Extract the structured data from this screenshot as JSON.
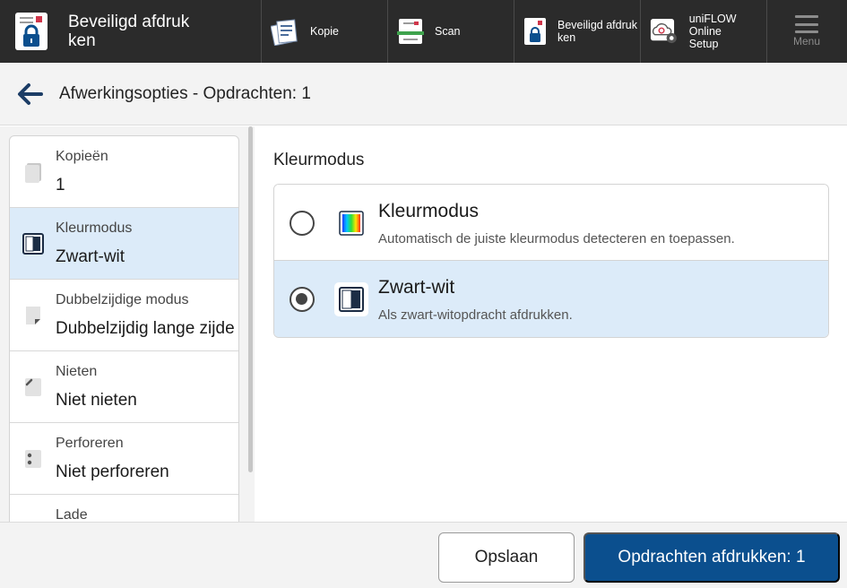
{
  "topbar": {
    "current_app": {
      "title_line1": "Beveiligd afdruk",
      "title_line2": "ken",
      "icon": "secure-print-icon"
    },
    "apps": [
      {
        "label": "Kopie",
        "icon": "copy-icon"
      },
      {
        "label": "Scan",
        "icon": "scan-icon"
      },
      {
        "label_line1": "Beveiligd afdruk",
        "label_line2": "ken",
        "icon": "secure-print-icon"
      },
      {
        "label_line1": "uniFLOW Online",
        "label_line2": "Setup",
        "icon": "cloud-settings-icon"
      }
    ],
    "menu": {
      "label": "Menu",
      "icon": "hamburger-icon"
    }
  },
  "titlebar": {
    "title": "Afwerkingsopties - Opdrachten: 1",
    "back_icon": "arrow-left-icon"
  },
  "settings": [
    {
      "name": "Kopieën",
      "value": "1",
      "icon": "copies-icon"
    },
    {
      "name": "Kleurmodus",
      "value": "Zwart-wit",
      "icon": "black-white-icon",
      "selected": true
    },
    {
      "name": "Dubbelzijdige modus",
      "value": "Dubbelzijdig lange zijde",
      "icon": "duplex-icon"
    },
    {
      "name": "Nieten",
      "value": "Niet nieten",
      "icon": "staple-icon"
    },
    {
      "name": "Perforeren",
      "value": "Niet perforeren",
      "icon": "punch-icon"
    },
    {
      "name": "Lade",
      "value": "",
      "icon": "tray-icon"
    }
  ],
  "color_mode": {
    "section_title": "Kleurmodus",
    "options": [
      {
        "title": "Kleurmodus",
        "description": "Automatisch de juiste kleurmodus detecteren en toepassen.",
        "icon": "color-gradient-icon",
        "selected": false
      },
      {
        "title": "Zwart-wit",
        "description": "Als zwart-witopdracht afdrukken.",
        "icon": "black-white-icon",
        "selected": true
      }
    ]
  },
  "footer": {
    "save_label": "Opslaan",
    "print_label": "Opdrachten afdrukken: 1"
  },
  "colors": {
    "topbar": "#2b2b2b",
    "selected": "#dcebf9",
    "primary_button": "#0b4f8e"
  }
}
